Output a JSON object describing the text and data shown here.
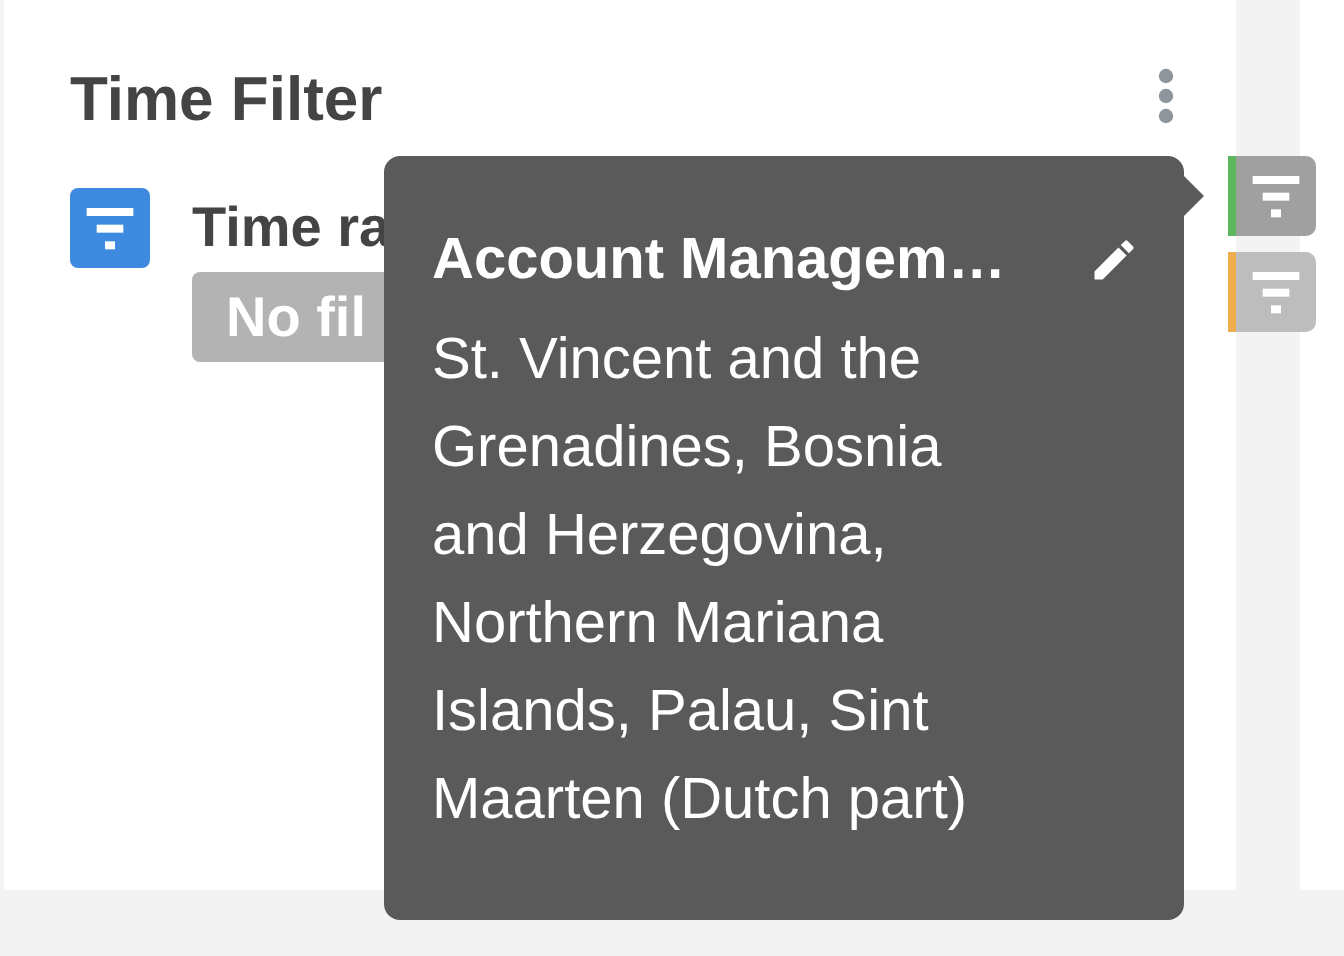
{
  "panel": {
    "title": "Time Filter",
    "filter": {
      "label": "Time ra",
      "value": "No fil"
    }
  },
  "tooltip": {
    "title": "Account Managem…",
    "text": "St. Vincent and the Grenadines, Bosnia and Herzegovina, Northern Mariana Islands, Palau, Sint Maarten (Dutch part)"
  },
  "side_filters": [
    {
      "color": "#5cb85c",
      "selected": true
    },
    {
      "color": "#f0ad4e",
      "selected": false
    }
  ]
}
